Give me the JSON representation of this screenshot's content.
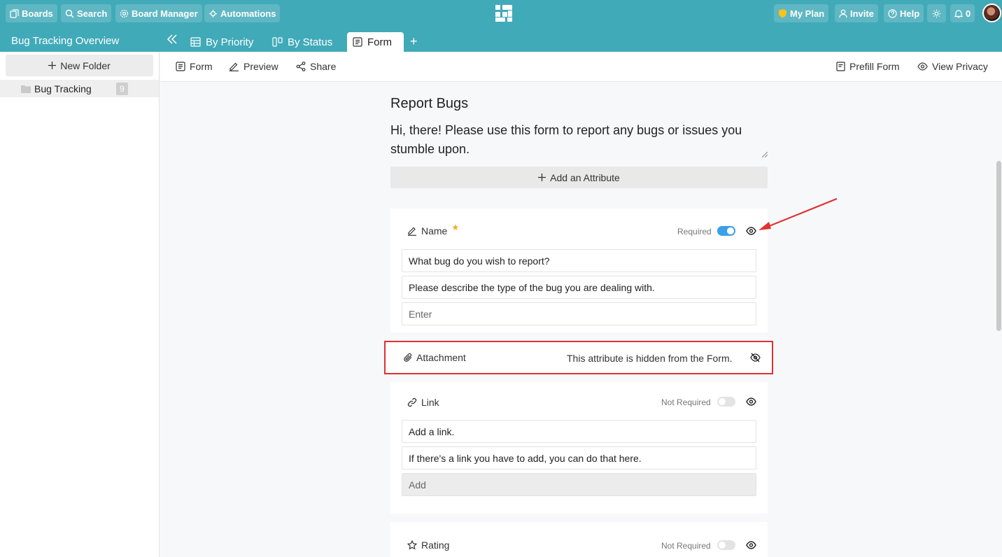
{
  "topbar": {
    "boards": "Boards",
    "search": "Search",
    "board_manager": "Board Manager",
    "automations": "Automations",
    "my_plan": "My Plan",
    "invite": "Invite",
    "help": "Help",
    "notifications": "0"
  },
  "subbar": {
    "project_title": "Bug Tracking Overview",
    "tabs": [
      {
        "label": "By Priority",
        "icon": "table-icon"
      },
      {
        "label": "By Status",
        "icon": "kanban-icon"
      },
      {
        "label": "Form",
        "icon": "form-icon",
        "active": true
      }
    ],
    "add_tab": "+"
  },
  "sidebar": {
    "new_folder": "New Folder",
    "folder": {
      "label": "Bug Tracking",
      "count": "9"
    }
  },
  "toolbar": {
    "form": "Form",
    "preview": "Preview",
    "share": "Share",
    "prefill": "Prefill Form",
    "privacy": "View Privacy"
  },
  "form": {
    "title": "Report Bugs",
    "description": "Hi, there! Please use this form to report any bugs or issues you stumble upon.",
    "add_attribute": "Add an Attribute",
    "fields": {
      "name": {
        "label": "Name",
        "required_label": "Required",
        "required": true,
        "question": "What bug do you wish to report?",
        "help": "Please describe the type of the bug you are dealing with.",
        "placeholder": "Enter"
      },
      "attachment": {
        "label": "Attachment",
        "note": "This attribute is hidden from the Form."
      },
      "link": {
        "label": "Link",
        "required_label": "Not Required",
        "required": false,
        "question": "Add a link.",
        "help": "If there's a link you have to add, you can do that here.",
        "placeholder": "Add"
      },
      "rating": {
        "label": "Rating",
        "required_label": "Not Required",
        "required": false
      }
    }
  },
  "colors": {
    "header": "#41aab8",
    "toggle_on": "#3aa0e8",
    "annotation": "#e03131",
    "star": "#f5a623"
  }
}
